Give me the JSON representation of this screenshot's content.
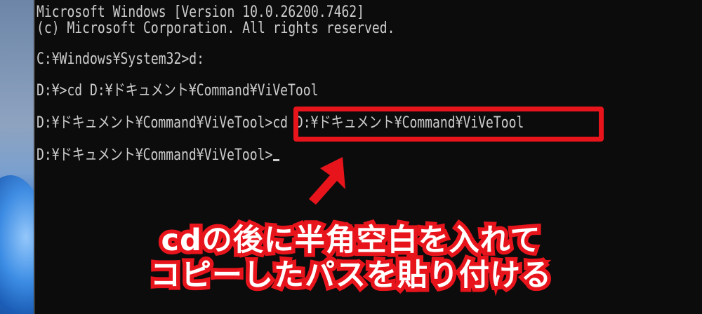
{
  "console": {
    "lines": [
      "Microsoft Windows [Version 10.0.26200.7462]",
      "(c) Microsoft Corporation. All rights reserved.",
      "C:¥Windows¥System32>d:",
      "D:¥>cd D:¥ドキュメント¥Command¥ViVeTool",
      "D:¥ドキュメント¥Command¥ViVeTool>cd D:¥ドキュメント¥Command¥ViVeTool",
      "D:¥ドキュメント¥Command¥ViVeTool>"
    ]
  },
  "annotation": {
    "caption_line1": "cdの後に半角空白を入れて",
    "caption_line2": "コピーしたパスを貼り付ける",
    "accent_color": "#e8141c",
    "arrow_icon": "arrow-up-icon"
  }
}
